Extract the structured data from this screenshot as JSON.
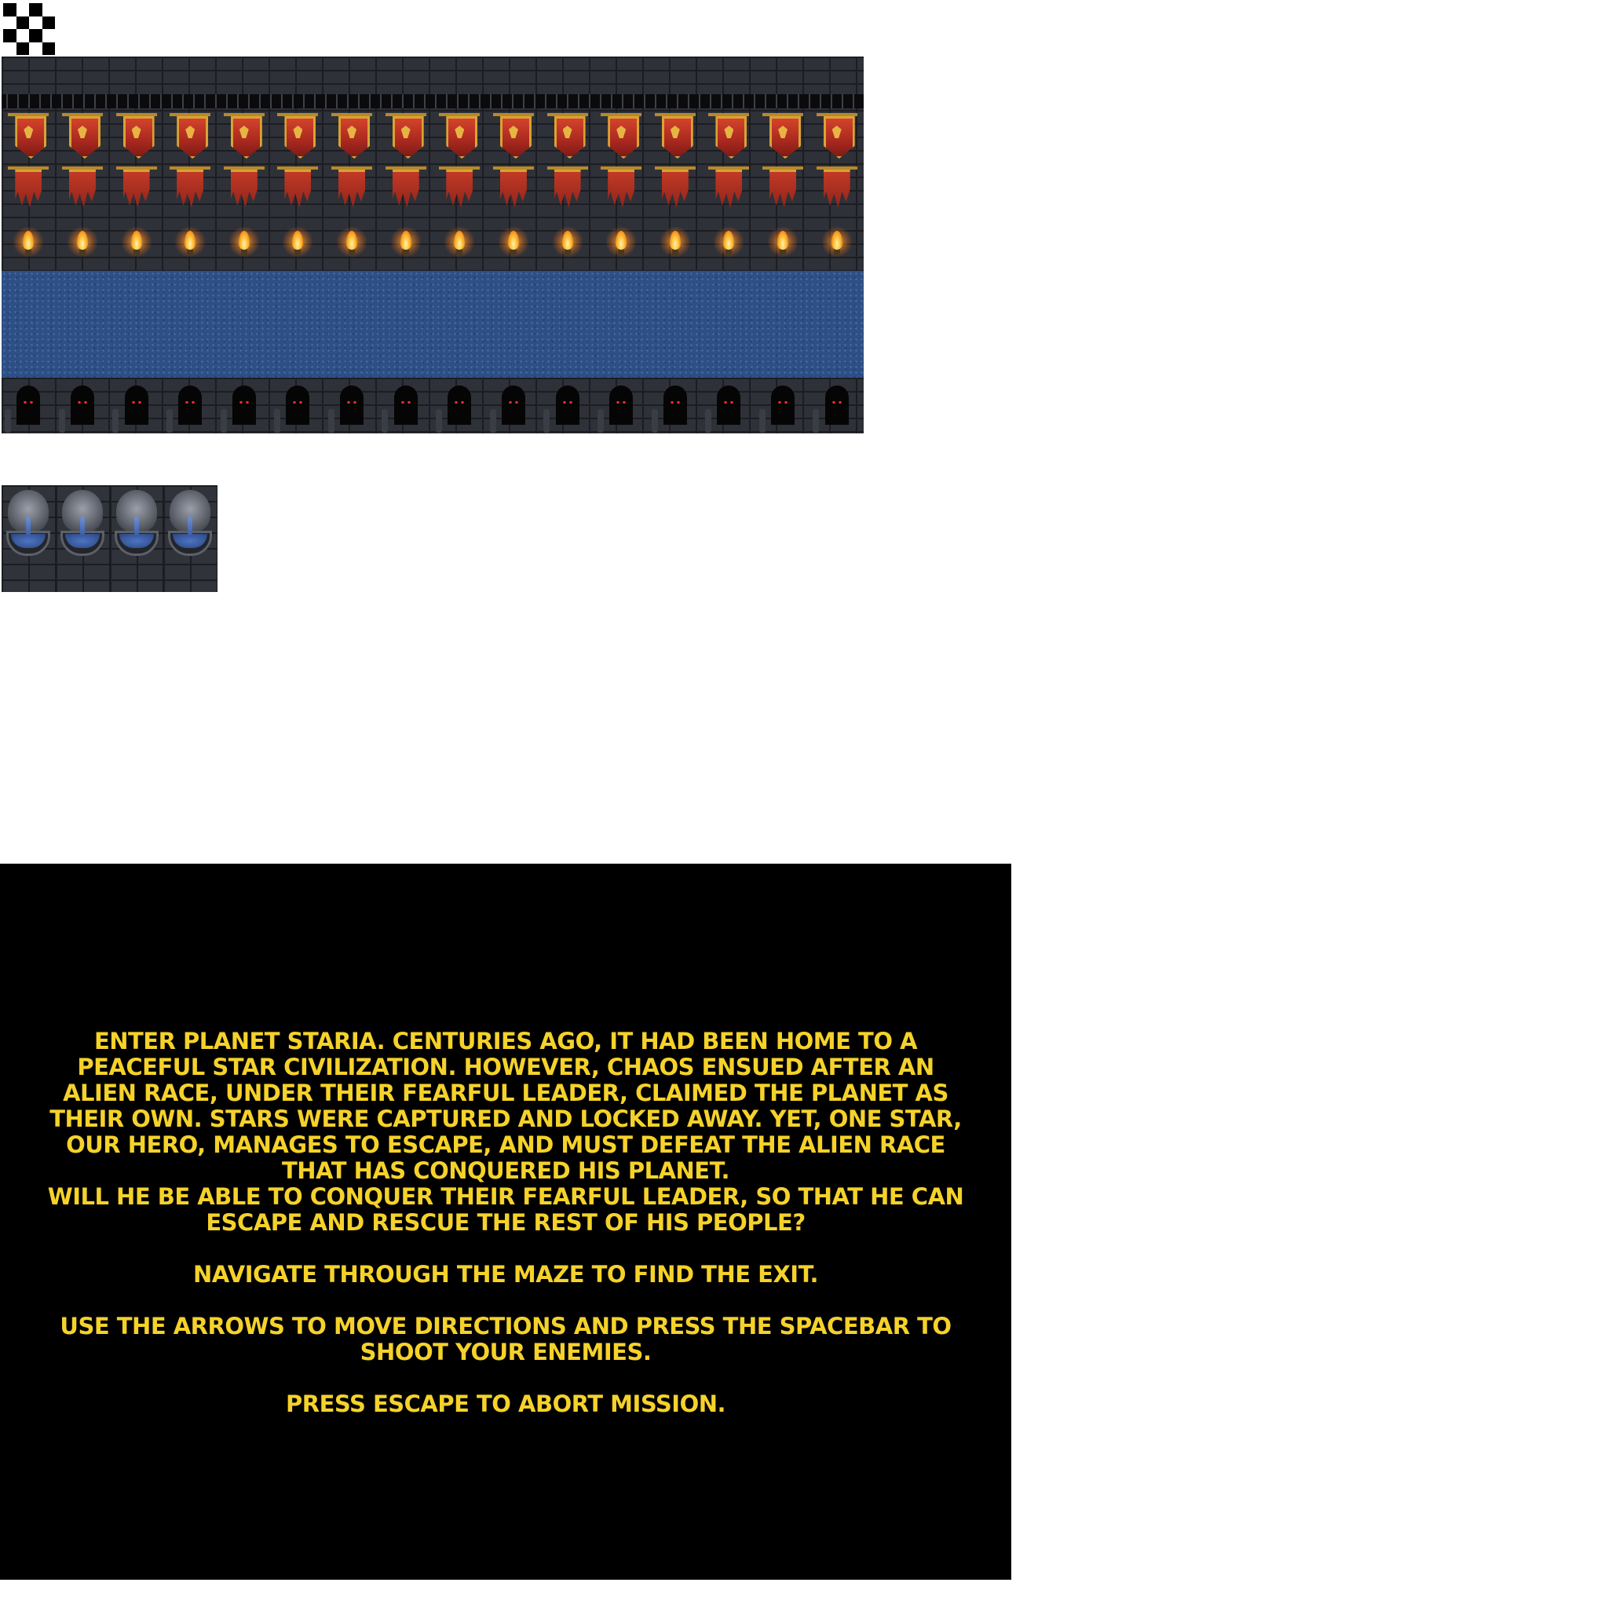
{
  "icons": {
    "checker": "checkerboard-sprite",
    "banner": "red-banner-icon",
    "torn_banner": "torn-banner-icon",
    "torch": "torch-icon",
    "arch": "dark-archway-icon",
    "fountain": "lion-fountain-icon"
  },
  "colors": {
    "story_background": "#000000",
    "story_text": "#f5d22a",
    "water": "#2e4f86",
    "stone": "#2f3138"
  },
  "story": {
    "intro": "ENTER PLANET STARIA. CENTURIES AGO, IT HAD BEEN HOME TO A PEACEFUL STAR CIVILIZATION. HOWEVER, CHAOS ENSUED AFTER AN ALIEN RACE, UNDER THEIR FEARFUL LEADER, CLAIMED THE PLANET AS THEIR OWN. STARS WERE CAPTURED AND LOCKED AWAY. YET, ONE STAR, OUR HERO, MANAGES TO ESCAPE, AND MUST DEFEAT THE ALIEN RACE THAT HAS CONQUERED HIS PLANET.",
    "question": "WILL HE BE ABLE TO CONQUER THEIR FEARFUL LEADER, SO THAT HE CAN ESCAPE AND RESCUE THE REST OF HIS PEOPLE?",
    "objective": "NAVIGATE THROUGH THE MAZE TO FIND THE EXIT.",
    "controls": "USE THE ARROWS TO MOVE DIRECTIONS AND PRESS THE SPACEBAR TO SHOOT YOUR ENEMIES.",
    "abort": "PRESS ESCAPE TO ABORT MISSION."
  }
}
